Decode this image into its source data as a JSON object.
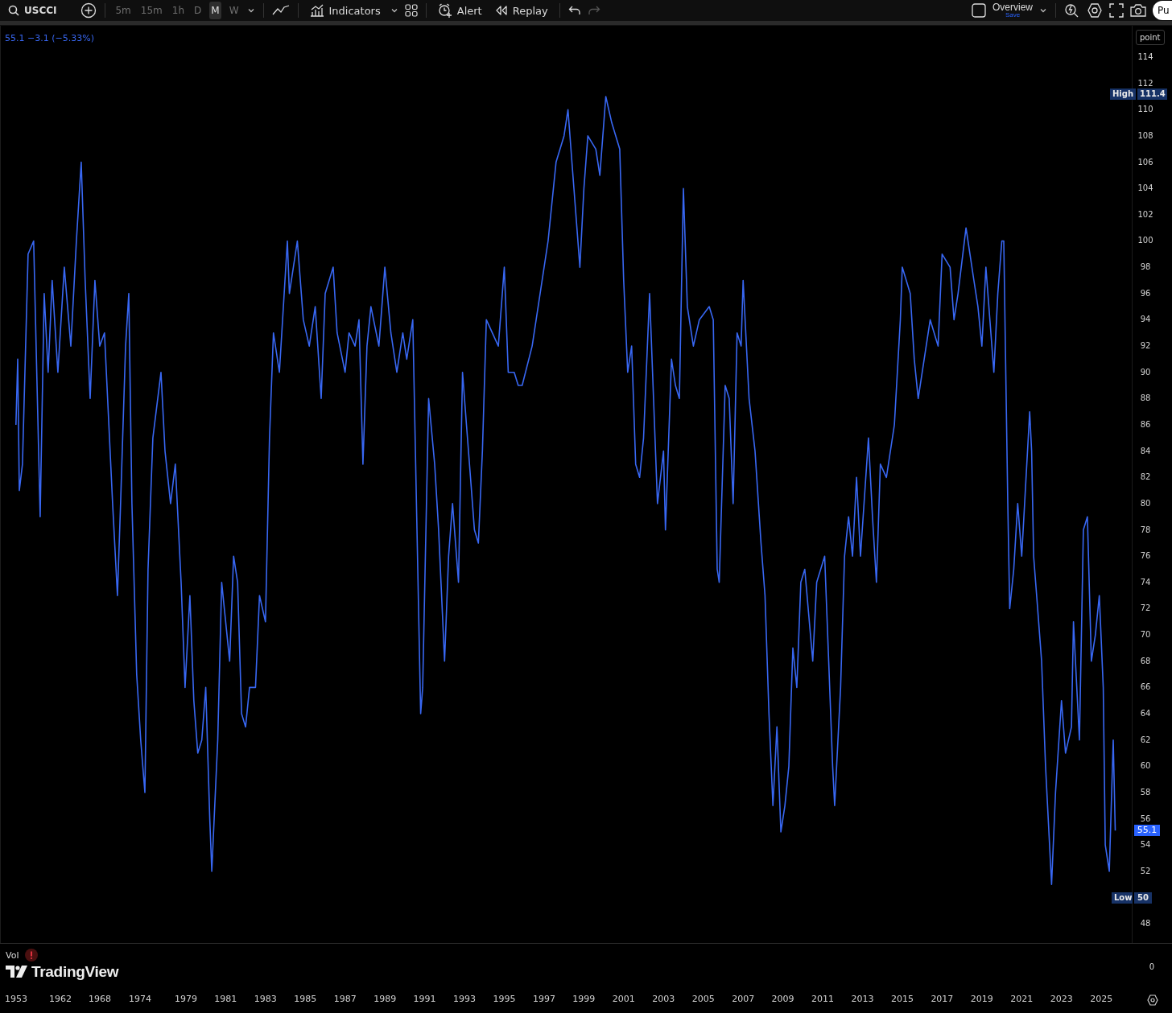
{
  "toolbar": {
    "intervals": [
      {
        "label": "5m",
        "selected": false
      },
      {
        "label": "15m",
        "selected": false
      },
      {
        "label": "1h",
        "selected": false
      },
      {
        "label": "D",
        "selected": false
      },
      {
        "label": "M",
        "selected": true
      },
      {
        "label": "W",
        "selected": false
      }
    ],
    "indicators_label": "Indicators",
    "alert_label": "Alert",
    "replay_label": "Replay",
    "redo_disabled": true,
    "layout": {
      "title": "Overview",
      "subtitle": "Save"
    },
    "publish_label": "Pu"
  },
  "legend": {
    "text": "55.1 −3.1 (−5.33%)"
  },
  "price_scale": {
    "mode": "point",
    "high": {
      "label": "High",
      "value": "111.4"
    },
    "low": {
      "label": "Low",
      "value": "50"
    },
    "last": "55.1"
  },
  "chart_data": {
    "type": "line",
    "xlim": [
      1969.66,
      2026.53
    ],
    "ylim": [
      46.54,
      116.39
    ],
    "x": [
      1970.46,
      1970.55,
      1970.63,
      1970.79,
      1971.07,
      1971.35,
      1971.68,
      1971.88,
      1972.08,
      1972.28,
      1972.57,
      1972.89,
      1973.22,
      1973.5,
      1973.74,
      1973.94,
      1974.19,
      1974.43,
      1974.67,
      1974.91,
      1975.32,
      1975.56,
      1975.72,
      1975.97,
      1976.13,
      1976.29,
      1976.53,
      1976.73,
      1976.94,
      1977.1,
      1977.34,
      1977.75,
      1977.95,
      1978.23,
      1978.47,
      1978.76,
      1978.96,
      1979.2,
      1979.4,
      1979.6,
      1979.8,
      1980.0,
      1980.2,
      1980.3,
      1980.6,
      1980.8,
      1981.2,
      1981.4,
      1981.6,
      1981.8,
      1982.0,
      1982.2,
      1982.5,
      1982.7,
      1983.0,
      1983.2,
      1983.4,
      1983.7,
      1984.1,
      1984.2,
      1984.6,
      1984.9,
      1985.2,
      1985.5,
      1985.8,
      1986.0,
      1986.4,
      1986.6,
      1987.0,
      1987.2,
      1987.5,
      1987.7,
      1987.9,
      1988.1,
      1988.3,
      1988.7,
      1989.0,
      1989.3,
      1989.6,
      1989.9,
      1990.1,
      1990.4,
      1990.6,
      1990.8,
      1990.9,
      1991.2,
      1991.5,
      1991.7,
      1992.0,
      1992.2,
      1992.4,
      1992.7,
      1992.9,
      1993.1,
      1993.3,
      1993.5,
      1993.7,
      1993.9,
      1994.1,
      1994.4,
      1994.7,
      1995.0,
      1995.2,
      1995.5,
      1995.7,
      1995.9,
      1996.4,
      1996.8,
      1997.2,
      1997.6,
      1998.0,
      1998.2,
      1998.5,
      1998.8,
      1999.0,
      1999.2,
      1999.6,
      1999.8,
      2000.1,
      2000.4,
      2000.8,
      2001.0,
      2001.2,
      2001.4,
      2001.6,
      2001.8,
      2002.0,
      2002.3,
      2002.5,
      2002.7,
      2003.0,
      2003.1,
      2003.4,
      2003.6,
      2003.8,
      2004.0,
      2004.2,
      2004.5,
      2004.8,
      2005.3,
      2005.5,
      2005.7,
      2005.8,
      2006.1,
      2006.3,
      2006.5,
      2006.7,
      2006.9,
      2007.0,
      2007.3,
      2007.6,
      2007.9,
      2008.1,
      2008.3,
      2008.5,
      2008.7,
      2008.9,
      2009.1,
      2009.3,
      2009.5,
      2009.7,
      2009.9,
      2010.1,
      2010.5,
      2010.7,
      2011.1,
      2011.3,
      2011.5,
      2011.6,
      2011.9,
      2012.1,
      2012.3,
      2012.5,
      2012.7,
      2012.9,
      2013.3,
      2013.5,
      2013.7,
      2013.9,
      2014.2,
      2014.6,
      2014.9,
      2015.0,
      2015.4,
      2015.6,
      2015.8,
      2016.2,
      2016.4,
      2016.8,
      2017.0,
      2017.4,
      2017.6,
      2017.8,
      2018.2,
      2018.4,
      2018.6,
      2018.8,
      2019.0,
      2019.2,
      2019.6,
      2019.8,
      2020.0,
      2020.1,
      2020.3,
      2020.4,
      2020.6,
      2020.8,
      2021.0,
      2021.4,
      2021.5,
      2021.6,
      2021.8,
      2022.0,
      2022.2,
      2022.5,
      2022.7,
      2023.0,
      2023.2,
      2023.5,
      2023.6,
      2023.9,
      2024.1,
      2024.3,
      2024.5,
      2024.7,
      2024.9,
      2025.1,
      2025.2,
      2025.4,
      2025.6,
      2025.7
    ],
    "series": [
      {
        "name": "USCCI",
        "color": "#3867f2",
        "values": [
          86,
          91,
          81,
          83,
          99,
          100,
          79,
          96,
          90,
          97,
          90,
          98,
          92,
          100,
          106,
          97,
          88,
          97,
          92,
          93,
          80,
          73,
          80,
          92,
          96,
          80,
          67,
          62,
          58,
          75,
          85,
          90,
          84,
          80,
          83,
          74,
          66,
          73,
          65,
          61,
          62,
          66,
          56,
          52,
          62,
          74,
          68,
          76,
          74,
          64,
          63,
          66,
          66,
          73,
          71,
          85,
          93,
          90,
          100,
          96,
          100,
          94,
          92,
          95,
          88,
          96,
          98,
          93,
          90,
          93,
          92,
          94,
          83,
          92,
          95,
          92,
          98,
          93,
          90,
          93,
          91,
          94,
          79,
          64,
          66,
          88,
          83,
          78,
          68,
          76,
          80,
          74,
          90,
          86,
          82,
          78,
          77,
          84,
          94,
          93,
          92,
          98,
          90,
          90,
          89,
          89,
          92,
          96,
          100,
          106,
          108,
          110,
          104,
          98,
          104,
          108,
          107,
          105,
          111,
          109,
          107,
          97,
          90,
          92,
          83,
          82,
          85,
          96,
          88,
          80,
          84,
          78,
          91,
          89,
          88,
          104,
          95,
          92,
          94,
          95,
          94,
          75,
          74,
          89,
          88,
          80,
          93,
          92,
          97,
          88,
          84,
          77,
          73,
          64,
          57,
          63,
          55,
          57,
          60,
          69,
          66,
          74,
          75,
          68,
          74,
          76,
          68,
          60,
          57,
          66,
          76,
          79,
          76,
          82,
          76,
          85,
          79,
          74,
          83,
          82,
          86,
          94,
          98,
          96,
          91,
          88,
          92,
          94,
          92,
          99,
          98,
          94,
          96,
          101,
          99,
          97,
          95,
          92,
          98,
          90,
          96,
          100,
          100,
          80,
          72,
          75,
          80,
          76,
          87,
          84,
          76,
          72,
          68,
          60,
          51,
          58,
          65,
          61,
          63,
          71,
          62,
          78,
          79,
          68,
          70,
          73,
          66,
          54,
          52,
          62,
          55.1
        ]
      }
    ],
    "xticks": [
      {
        "value": 1979,
        "label": "1979"
      },
      {
        "value": 1981,
        "label": "1981"
      },
      {
        "value": 1983,
        "label": "1983"
      },
      {
        "value": 1985,
        "label": "1985"
      },
      {
        "value": 1987,
        "label": "1987"
      },
      {
        "value": 1989,
        "label": "1989"
      },
      {
        "value": 1991,
        "label": "1991"
      },
      {
        "value": 1993,
        "label": "1993"
      },
      {
        "value": 1995,
        "label": "1995"
      },
      {
        "value": 1997,
        "label": "1997"
      },
      {
        "value": 1999,
        "label": "1999"
      },
      {
        "value": 2001,
        "label": "2001"
      },
      {
        "value": 2003,
        "label": "2003"
      },
      {
        "value": 2005,
        "label": "2005"
      },
      {
        "value": 2007,
        "label": "2007"
      },
      {
        "value": 2009,
        "label": "2009"
      },
      {
        "value": 2011,
        "label": "2011"
      },
      {
        "value": 2013,
        "label": "2013"
      },
      {
        "value": 2015,
        "label": "2015"
      },
      {
        "value": 2017,
        "label": "2017"
      },
      {
        "value": 2019,
        "label": "2019"
      },
      {
        "value": 2021,
        "label": "2021"
      },
      {
        "value": 2023,
        "label": "2023"
      },
      {
        "value": 2025,
        "label": "2025"
      }
    ],
    "yticks": [
      {
        "value": 114,
        "label": "114"
      },
      {
        "value": 112,
        "label": "112"
      },
      {
        "value": 110,
        "label": "110"
      },
      {
        "value": 108,
        "label": "108"
      },
      {
        "value": 106,
        "label": "106"
      },
      {
        "value": 104,
        "label": "104"
      },
      {
        "value": 102,
        "label": "102"
      },
      {
        "value": 100,
        "label": "100"
      },
      {
        "value": 98,
        "label": "98"
      },
      {
        "value": 96,
        "label": "96"
      },
      {
        "value": 94,
        "label": "94"
      },
      {
        "value": 92,
        "label": "92"
      },
      {
        "value": 90,
        "label": "90"
      },
      {
        "value": 88,
        "label": "88"
      },
      {
        "value": 86,
        "label": "86"
      },
      {
        "value": 84,
        "label": "84"
      },
      {
        "value": 82,
        "label": "82"
      },
      {
        "value": 80,
        "label": "80"
      },
      {
        "value": 78,
        "label": "78"
      },
      {
        "value": 76,
        "label": "76"
      },
      {
        "value": 74,
        "label": "74"
      },
      {
        "value": 72,
        "label": "72"
      },
      {
        "value": 70,
        "label": "70"
      },
      {
        "value": 68,
        "label": "68"
      },
      {
        "value": 66,
        "label": "66"
      },
      {
        "value": 64,
        "label": "64"
      },
      {
        "value": 62,
        "label": "62"
      },
      {
        "value": 60,
        "label": "60"
      },
      {
        "value": 58,
        "label": "58"
      },
      {
        "value": 56,
        "label": "56"
      },
      {
        "value": 54,
        "label": "54"
      },
      {
        "value": 52,
        "label": "52"
      },
      {
        "value": 48,
        "label": "48"
      }
    ]
  },
  "volume": {
    "label": "Vol",
    "error": true,
    "scale_label": "0"
  },
  "branding": "TradingView",
  "time_scale": {
    "early_labels": [
      "1953",
      "1962",
      "1968",
      "1974"
    ]
  }
}
